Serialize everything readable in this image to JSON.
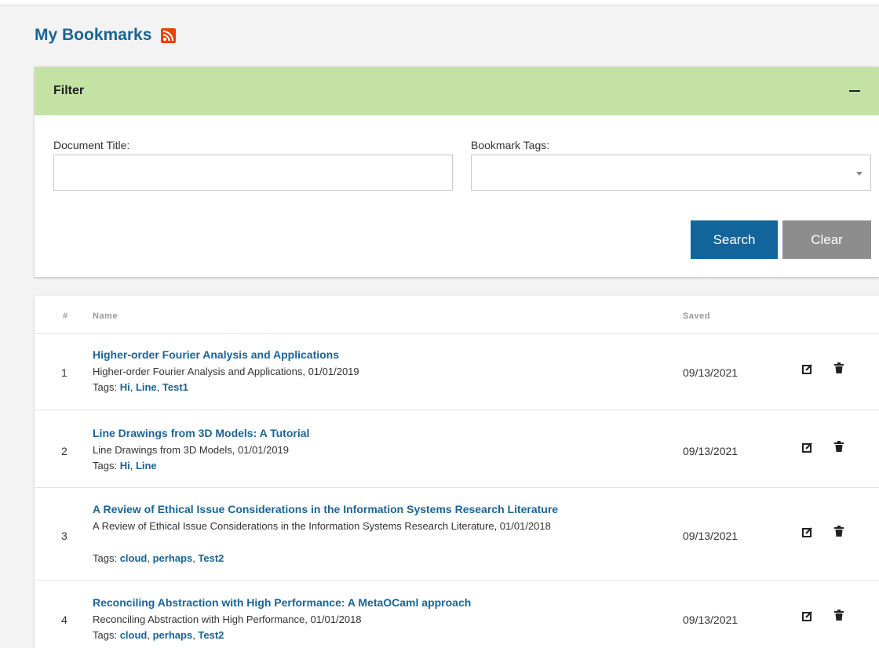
{
  "page": {
    "title": "My Bookmarks",
    "rss_icon": "rss-icon"
  },
  "filter": {
    "title": "Filter",
    "collapse_icon": "minus-icon",
    "document_title_label": "Document Title:",
    "document_title_value": "",
    "tags_label": "Bookmark Tags:",
    "tags_value": "",
    "search_label": "Search",
    "clear_label": "Clear"
  },
  "table": {
    "headers": {
      "num": "#",
      "name": "Name",
      "saved": "Saved"
    },
    "rows": [
      {
        "num": "1",
        "title": "Higher-order Fourier Analysis and Applications",
        "desc": "Higher-order Fourier Analysis and Applications, 01/01/2019",
        "tags_label": "Tags:",
        "tags": [
          "Hi",
          "Line",
          "Test1"
        ],
        "saved": "09/13/2021"
      },
      {
        "num": "2",
        "title": "Line Drawings from 3D Models: A Tutorial",
        "desc": "Line Drawings from 3D Models, 01/01/2019",
        "tags_label": "Tags:",
        "tags": [
          "Hi",
          "Line"
        ],
        "saved": "09/13/2021"
      },
      {
        "num": "3",
        "title": "A Review of Ethical Issue Considerations in the Information Systems Research Literature",
        "desc": "A Review of Ethical Issue Considerations in the Information Systems Research Literature, 01/01/2018",
        "tags_label": "Tags:",
        "tags": [
          "cloud",
          "perhaps",
          "Test2"
        ],
        "saved": "09/13/2021"
      },
      {
        "num": "4",
        "title": "Reconciling Abstraction with High Performance: A MetaOCaml approach",
        "desc": "Reconciling Abstraction with High Performance, 01/01/2018",
        "tags_label": "Tags:",
        "tags": [
          "cloud",
          "perhaps",
          "Test2"
        ],
        "saved": "09/13/2021"
      }
    ]
  },
  "colors": {
    "accent": "#1a6496",
    "filter_header": "#c5e2a5",
    "search_button": "#11659c",
    "clear_button": "#8d8d8d",
    "rss": "#e8440a"
  }
}
